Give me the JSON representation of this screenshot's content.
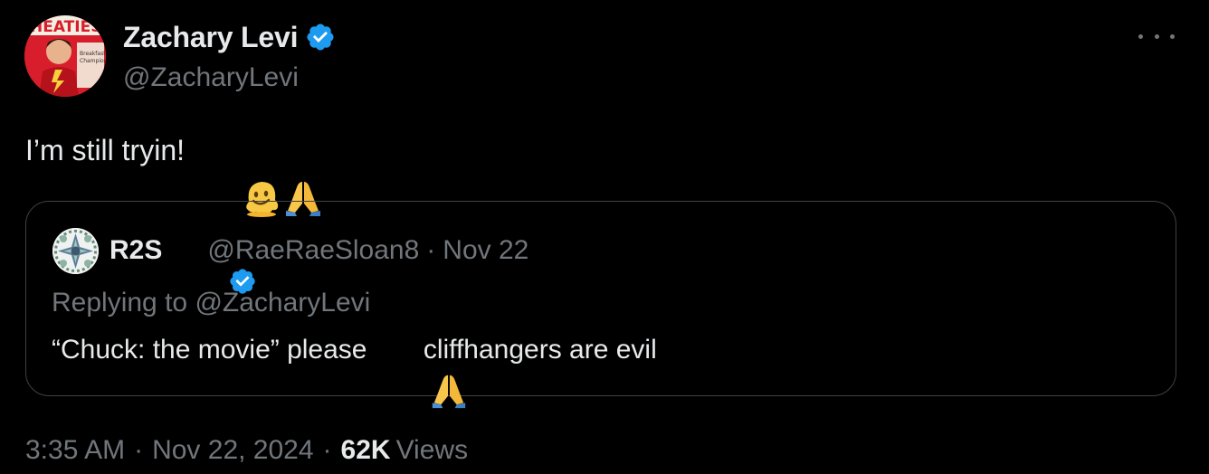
{
  "tweet": {
    "author": {
      "display_name": "Zachary Levi",
      "handle": "@ZacharyLevi",
      "verified": true,
      "avatar_icon": "avatar-superhero-cereal-box"
    },
    "text": "I’m still tryin! ",
    "emojis": [
      "melting-face-icon",
      "folded-hands-icon"
    ],
    "more_icon": "more-options-icon",
    "quote": {
      "author": {
        "display_name": "R2S",
        "handle": "@RaeRaeSloan8",
        "verified": true,
        "avatar_icon": "avatar-kaleidoscope-pattern"
      },
      "separator": "·",
      "date": "Nov 22",
      "replying_prefix": "Replying to ",
      "replying_to": "@ZacharyLevi",
      "text_before": "“Chuck: the movie” please",
      "text_after": " cliffhangers are evil",
      "emoji": "folded-hands-icon"
    },
    "meta": {
      "time": "3:35 AM",
      "separator": "·",
      "date": "Nov 22, 2024",
      "views_count": "62K",
      "views_label": "Views"
    }
  },
  "colors": {
    "background": "#000000",
    "primary_text": "#e7e9ea",
    "secondary_text": "#71767b",
    "border": "#3e4144",
    "verified_badge": "#1d9bf0"
  }
}
